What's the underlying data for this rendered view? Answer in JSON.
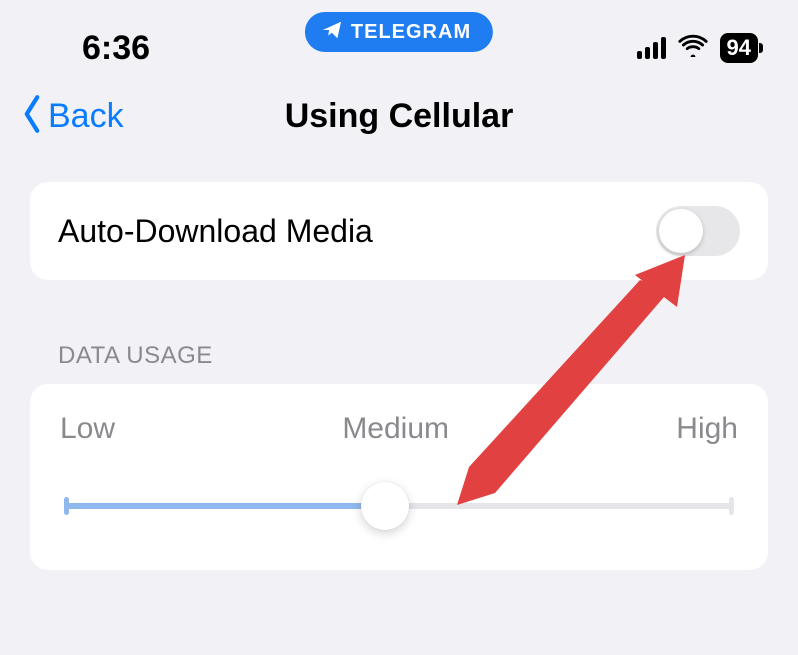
{
  "status": {
    "time": "6:36",
    "app_pill_label": "TELEGRAM",
    "battery_percent": "94"
  },
  "nav": {
    "back_label": "Back",
    "title": "Using Cellular"
  },
  "settings": {
    "auto_download": {
      "label": "Auto-Download Media",
      "enabled": false
    },
    "data_usage": {
      "section_header": "DATA USAGE",
      "labels": {
        "low": "Low",
        "medium": "Medium",
        "high": "High"
      },
      "value": "medium",
      "options": [
        "low",
        "medium",
        "high"
      ]
    }
  },
  "colors": {
    "accent": "#0a7cff",
    "pill": "#1f7cf1",
    "arrow": "#e24141",
    "slider_fill": "#8fb8ef",
    "bg": "#f2f2f6"
  }
}
